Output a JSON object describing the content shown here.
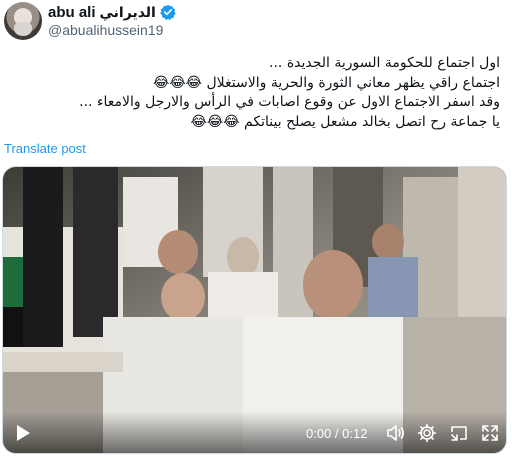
{
  "author": {
    "name_latin": "abu ali",
    "name_arabic": "الديراني",
    "handle": "@abualihussein19",
    "avatar_icon": "profile-avatar",
    "verified_icon": "verified-badge-icon",
    "verified_color": "#1d9bf0"
  },
  "tweet": {
    "lines": [
      "اول اجتماع للحكومة السورية الجديدة ...",
      "اجتماع راقي يظهر معاني الثورة والحرية والاستغلال 😂😂😂",
      "وقد اسفر الاجتماع الاول عن وقوع اصابات في الرأس والارجل والامعاء ...",
      "يا جماعة رح اتصل بخالد مشعل يصلح بيناتكم 😂😂😂"
    ]
  },
  "translate_label": "Translate post",
  "video": {
    "time_display": "0:00 / 0:12",
    "play_icon": "play-icon",
    "volume_icon": "volume-icon",
    "settings_icon": "gear-icon",
    "pip_icon": "picture-in-picture-icon",
    "fullscreen_icon": "fullscreen-icon"
  },
  "colors": {
    "link": "#1d9bf0",
    "secondary_text": "#536471",
    "primary_text": "#0f1419"
  }
}
